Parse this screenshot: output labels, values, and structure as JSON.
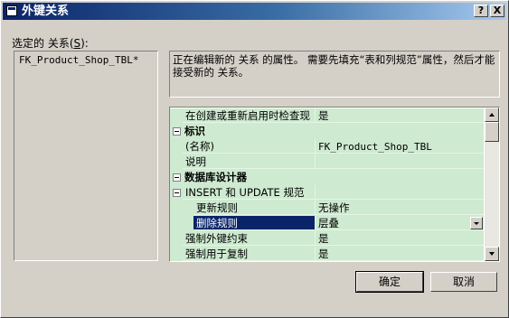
{
  "window": {
    "title": "外键关系",
    "help_label": "?",
    "close_label": "X"
  },
  "left": {
    "label_prefix": "选定的 关系(",
    "label_hotkey": "S",
    "label_suffix": "):",
    "items": [
      "FK_Product_Shop_TBL*"
    ]
  },
  "info": {
    "text": "正在编辑新的 关系 的属性。 需要先填充“表和列规范”属性，然后才能接受新的 关系。"
  },
  "grid": {
    "rows": [
      {
        "kind": "prop",
        "name": "在创建或重新启用时检查现",
        "value": "是",
        "indent": 1
      },
      {
        "kind": "cat",
        "name": "标识"
      },
      {
        "kind": "prop",
        "name": "(名称)",
        "value": "FK_Product_Shop_TBL",
        "indent": 1,
        "mono": true
      },
      {
        "kind": "prop",
        "name": "说明",
        "value": "",
        "indent": 1
      },
      {
        "kind": "cat",
        "name": "数据库设计器"
      },
      {
        "kind": "subcat",
        "name": "INSERT 和 UPDATE 规范",
        "value": ""
      },
      {
        "kind": "prop",
        "name": "更新规则",
        "value": "无操作",
        "indent": 2
      },
      {
        "kind": "prop",
        "name": "删除规则",
        "value": "层叠",
        "indent": 2,
        "selected": true,
        "dropdown": true
      },
      {
        "kind": "prop",
        "name": "强制外键约束",
        "value": "是",
        "indent": 1
      },
      {
        "kind": "prop",
        "name": "强制用于复制",
        "value": "是",
        "indent": 1
      }
    ]
  },
  "buttons": {
    "ok": "确定",
    "cancel": "取消"
  }
}
